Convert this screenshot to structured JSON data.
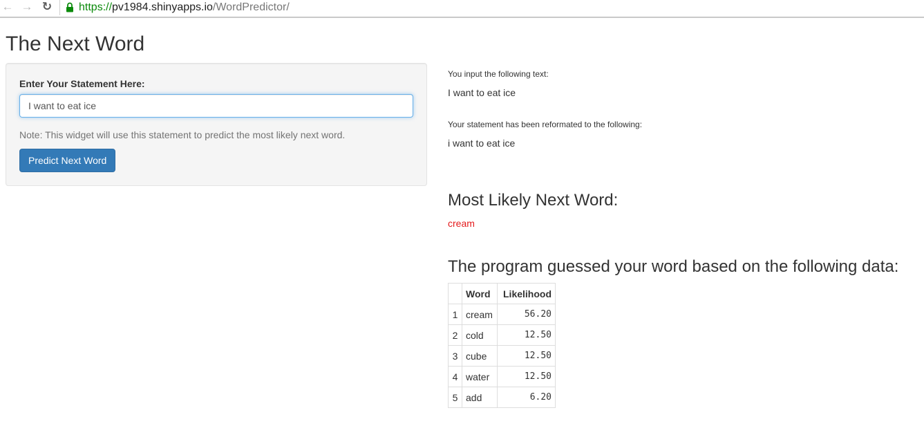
{
  "browser": {
    "url_scheme": "https://",
    "url_host": "pv1984.shinyapps.io",
    "url_path": "/WordPredictor/",
    "icons": [
      "back-icon",
      "forward-icon",
      "reload-icon",
      "lock-icon"
    ]
  },
  "page": {
    "title": "The Next Word"
  },
  "form": {
    "label": "Enter Your Statement Here:",
    "input_value": "I want to eat ice",
    "note": "Note: This widget will use this statement to predict the most likely next word.",
    "button_label": "Predict Next Word",
    "button_color": "#337ab7"
  },
  "output": {
    "input_caption": "You input the following text:",
    "input_text": "I want to eat ice",
    "reformat_caption": "Your statement has been reformated to the following:",
    "reformat_text": "i want to eat ice",
    "prediction_heading": "Most Likely Next Word:",
    "prediction_word": "cream",
    "prediction_color": "#e41a1c",
    "table_heading": "The program guessed your word based on the following data:"
  },
  "table": {
    "columns": [
      "",
      "Word",
      "Likelihood"
    ],
    "rows": [
      {
        "index": "1",
        "word": "cream",
        "likelihood": "56.20"
      },
      {
        "index": "2",
        "word": "cold",
        "likelihood": "12.50"
      },
      {
        "index": "3",
        "word": "cube",
        "likelihood": "12.50"
      },
      {
        "index": "4",
        "word": "water",
        "likelihood": "12.50"
      },
      {
        "index": "5",
        "word": "add",
        "likelihood": "6.20"
      }
    ]
  }
}
